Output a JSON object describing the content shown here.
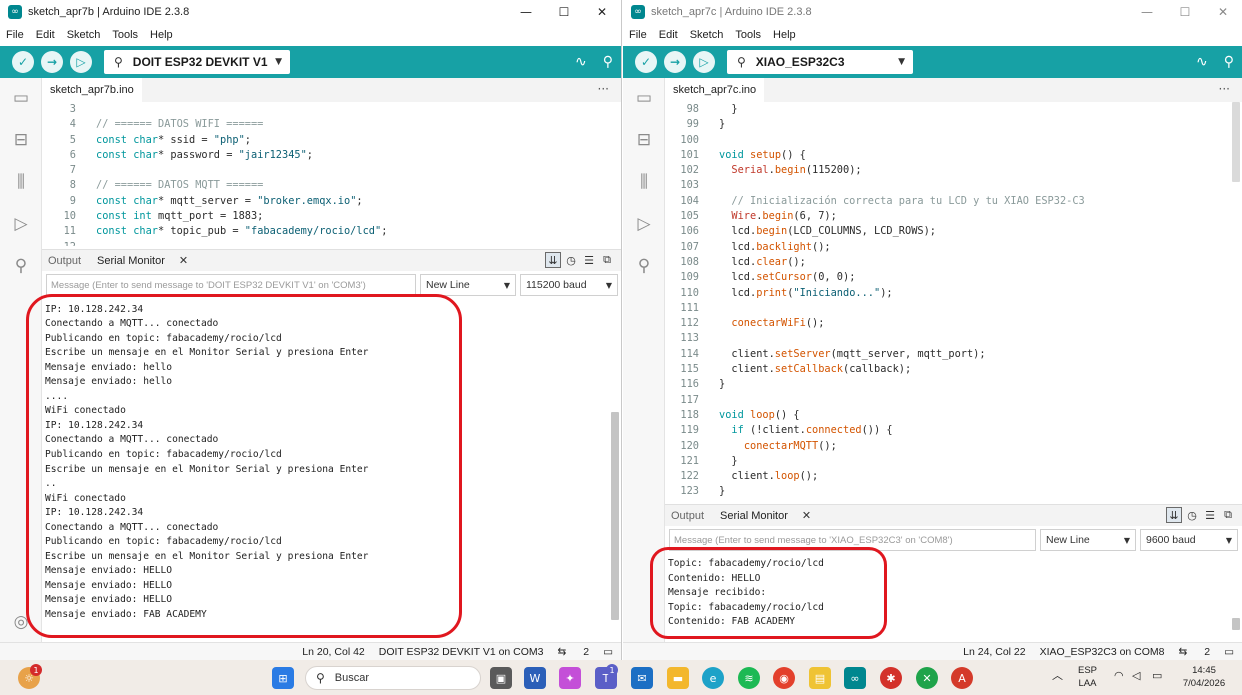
{
  "left_window": {
    "title": "sketch_apr7b | Arduino IDE 2.3.8",
    "menu": [
      "File",
      "Edit",
      "Sketch",
      "Tools",
      "Help"
    ],
    "board": "DOIT ESP32 DEVKIT V1",
    "file_tab": "sketch_apr7b.ino",
    "code": [
      {
        "n": "3",
        "parts": []
      },
      {
        "n": "4",
        "parts": [
          {
            "c": "cm",
            "t": "// ====== DATOS WIFI ======"
          }
        ]
      },
      {
        "n": "5",
        "parts": [
          {
            "c": "ty",
            "t": "const char"
          },
          {
            "c": "nm",
            "t": "* ssid = "
          },
          {
            "c": "st",
            "t": "\"php\""
          },
          {
            "c": "nm",
            "t": ";"
          }
        ]
      },
      {
        "n": "6",
        "parts": [
          {
            "c": "ty",
            "t": "const char"
          },
          {
            "c": "nm",
            "t": "* password = "
          },
          {
            "c": "st",
            "t": "\"jair12345\""
          },
          {
            "c": "nm",
            "t": ";"
          }
        ]
      },
      {
        "n": "7",
        "parts": []
      },
      {
        "n": "8",
        "parts": [
          {
            "c": "cm",
            "t": "// ====== DATOS MQTT ======"
          }
        ]
      },
      {
        "n": "9",
        "parts": [
          {
            "c": "ty",
            "t": "const char"
          },
          {
            "c": "nm",
            "t": "* mqtt_server = "
          },
          {
            "c": "st",
            "t": "\"broker.emqx.io\""
          },
          {
            "c": "nm",
            "t": ";"
          }
        ]
      },
      {
        "n": "10",
        "parts": [
          {
            "c": "ty",
            "t": "const int"
          },
          {
            "c": "nm",
            "t": " mqtt_port = 1883;"
          }
        ]
      },
      {
        "n": "11",
        "parts": [
          {
            "c": "ty",
            "t": "const char"
          },
          {
            "c": "nm",
            "t": "* topic_pub = "
          },
          {
            "c": "st",
            "t": "\"fabacademy/rocio/lcd\""
          },
          {
            "c": "nm",
            "t": ";"
          }
        ]
      },
      {
        "n": "12",
        "parts": []
      }
    ],
    "panel_tabs": [
      "Output",
      "Serial Monitor"
    ],
    "serial_placeholder": "Message (Enter to send message to 'DOIT ESP32 DEVKIT V1' on 'COM3')",
    "line_ending": "New Line",
    "baud": "115200 baud",
    "serial_lines": [
      "WiFi conectado",
      "IP: 10.128.242.34",
      "Conectando a MQTT... conectado",
      "Publicando en topic: fabacademy/rocio/lcd",
      "Escribe un mensaje en el Monitor Serial y presiona Enter",
      "Mensaje enviado: hello",
      "Mensaje enviado: hello",
      "....",
      "WiFi conectado",
      "IP: 10.128.242.34",
      "Conectando a MQTT... conectado",
      "Publicando en topic: fabacademy/rocio/lcd",
      "Escribe un mensaje en el Monitor Serial y presiona Enter",
      "..",
      "WiFi conectado",
      "IP: 10.128.242.34",
      "Conectando a MQTT... conectado",
      "Publicando en topic: fabacademy/rocio/lcd",
      "Escribe un mensaje en el Monitor Serial y presiona Enter",
      "Mensaje enviado: HELLO",
      "Mensaje enviado: HELLO",
      "Mensaje enviado: HELLO",
      "Mensaje enviado: FAB ACADEMY"
    ],
    "status": {
      "position": "Ln 20, Col 42",
      "board_port": "DOIT ESP32 DEVKIT V1 on COM3",
      "notifications": "2"
    }
  },
  "right_window": {
    "title": "sketch_apr7c | Arduino IDE 2.3.8",
    "menu": [
      "File",
      "Edit",
      "Sketch",
      "Tools",
      "Help"
    ],
    "board": "XIAO_ESP32C3",
    "file_tab": "sketch_apr7c.ino",
    "code": [
      {
        "n": "98",
        "parts": [
          {
            "c": "nm",
            "t": "  }"
          }
        ]
      },
      {
        "n": "99",
        "parts": [
          {
            "c": "nm",
            "t": "}"
          }
        ]
      },
      {
        "n": "100",
        "parts": []
      },
      {
        "n": "101",
        "parts": [
          {
            "c": "ty",
            "t": "void"
          },
          {
            "c": "nm",
            "t": " "
          },
          {
            "c": "fn",
            "t": "setup"
          },
          {
            "c": "nm",
            "t": "() {"
          }
        ]
      },
      {
        "n": "102",
        "parts": [
          {
            "c": "nm",
            "t": "  "
          },
          {
            "c": "ob",
            "t": "Serial"
          },
          {
            "c": "nm",
            "t": "."
          },
          {
            "c": "fn",
            "t": "begin"
          },
          {
            "c": "nm",
            "t": "(115200);"
          }
        ]
      },
      {
        "n": "103",
        "parts": []
      },
      {
        "n": "104",
        "parts": [
          {
            "c": "cm",
            "t": "  // Inicialización correcta para tu LCD y tu XIAO ESP32-C3"
          }
        ]
      },
      {
        "n": "105",
        "parts": [
          {
            "c": "nm",
            "t": "  "
          },
          {
            "c": "ob",
            "t": "Wire"
          },
          {
            "c": "nm",
            "t": "."
          },
          {
            "c": "fn",
            "t": "begin"
          },
          {
            "c": "nm",
            "t": "(6, 7);"
          }
        ]
      },
      {
        "n": "106",
        "parts": [
          {
            "c": "nm",
            "t": "  lcd."
          },
          {
            "c": "fn",
            "t": "begin"
          },
          {
            "c": "nm",
            "t": "(LCD_COLUMNS, LCD_ROWS);"
          }
        ]
      },
      {
        "n": "107",
        "parts": [
          {
            "c": "nm",
            "t": "  lcd."
          },
          {
            "c": "fn",
            "t": "backlight"
          },
          {
            "c": "nm",
            "t": "();"
          }
        ]
      },
      {
        "n": "108",
        "parts": [
          {
            "c": "nm",
            "t": "  lcd."
          },
          {
            "c": "fn",
            "t": "clear"
          },
          {
            "c": "nm",
            "t": "();"
          }
        ]
      },
      {
        "n": "109",
        "parts": [
          {
            "c": "nm",
            "t": "  lcd."
          },
          {
            "c": "fn",
            "t": "setCursor"
          },
          {
            "c": "nm",
            "t": "(0, 0);"
          }
        ]
      },
      {
        "n": "110",
        "parts": [
          {
            "c": "nm",
            "t": "  lcd."
          },
          {
            "c": "fn",
            "t": "print"
          },
          {
            "c": "nm",
            "t": "("
          },
          {
            "c": "st",
            "t": "\"Iniciando...\""
          },
          {
            "c": "nm",
            "t": ");"
          }
        ]
      },
      {
        "n": "111",
        "parts": []
      },
      {
        "n": "112",
        "parts": [
          {
            "c": "nm",
            "t": "  "
          },
          {
            "c": "fn",
            "t": "conectarWiFi"
          },
          {
            "c": "nm",
            "t": "();"
          }
        ]
      },
      {
        "n": "113",
        "parts": []
      },
      {
        "n": "114",
        "parts": [
          {
            "c": "nm",
            "t": "  client."
          },
          {
            "c": "fn",
            "t": "setServer"
          },
          {
            "c": "nm",
            "t": "(mqtt_server, mqtt_port);"
          }
        ]
      },
      {
        "n": "115",
        "parts": [
          {
            "c": "nm",
            "t": "  client."
          },
          {
            "c": "fn",
            "t": "setCallback"
          },
          {
            "c": "nm",
            "t": "(callback);"
          }
        ]
      },
      {
        "n": "116",
        "parts": [
          {
            "c": "nm",
            "t": "}"
          }
        ]
      },
      {
        "n": "117",
        "parts": []
      },
      {
        "n": "118",
        "parts": [
          {
            "c": "ty",
            "t": "void"
          },
          {
            "c": "nm",
            "t": " "
          },
          {
            "c": "fn",
            "t": "loop"
          },
          {
            "c": "nm",
            "t": "() {"
          }
        ]
      },
      {
        "n": "119",
        "parts": [
          {
            "c": "nm",
            "t": "  "
          },
          {
            "c": "kw",
            "t": "if"
          },
          {
            "c": "nm",
            "t": " (!client."
          },
          {
            "c": "fn",
            "t": "connected"
          },
          {
            "c": "nm",
            "t": "()) {"
          }
        ]
      },
      {
        "n": "120",
        "parts": [
          {
            "c": "nm",
            "t": "    "
          },
          {
            "c": "fn",
            "t": "conectarMQTT"
          },
          {
            "c": "nm",
            "t": "();"
          }
        ]
      },
      {
        "n": "121",
        "parts": [
          {
            "c": "nm",
            "t": "  }"
          }
        ]
      },
      {
        "n": "122",
        "parts": [
          {
            "c": "nm",
            "t": "  client."
          },
          {
            "c": "fn",
            "t": "loop"
          },
          {
            "c": "nm",
            "t": "();"
          }
        ]
      },
      {
        "n": "123",
        "parts": [
          {
            "c": "nm",
            "t": "}"
          }
        ]
      }
    ],
    "panel_tabs": [
      "Output",
      "Serial Monitor"
    ],
    "serial_placeholder": "Message (Enter to send message to 'XIAO_ESP32C3' on 'COM8')",
    "line_ending": "New Line",
    "baud": "9600 baud",
    "serial_lines": [
      "Topic: fabacademy/rocio/lcd",
      "Contenido: HELLO",
      "Mensaje recibido:",
      "Topic: fabacademy/rocio/lcd",
      "Contenido: FAB ACADEMY"
    ],
    "status": {
      "position": "Ln 24, Col 22",
      "board_port": "XIAO_ESP32C3 on COM8",
      "notifications": "2"
    }
  },
  "taskbar": {
    "search_label": "Buscar",
    "language": "ESP",
    "language_sub": "LAA",
    "time": "14:45",
    "date": "7/04/2026",
    "weather_badge": "1",
    "teams_badge": "1"
  },
  "colors": {
    "toolbar": "#17a1a5",
    "annotation": "#e0171f"
  }
}
